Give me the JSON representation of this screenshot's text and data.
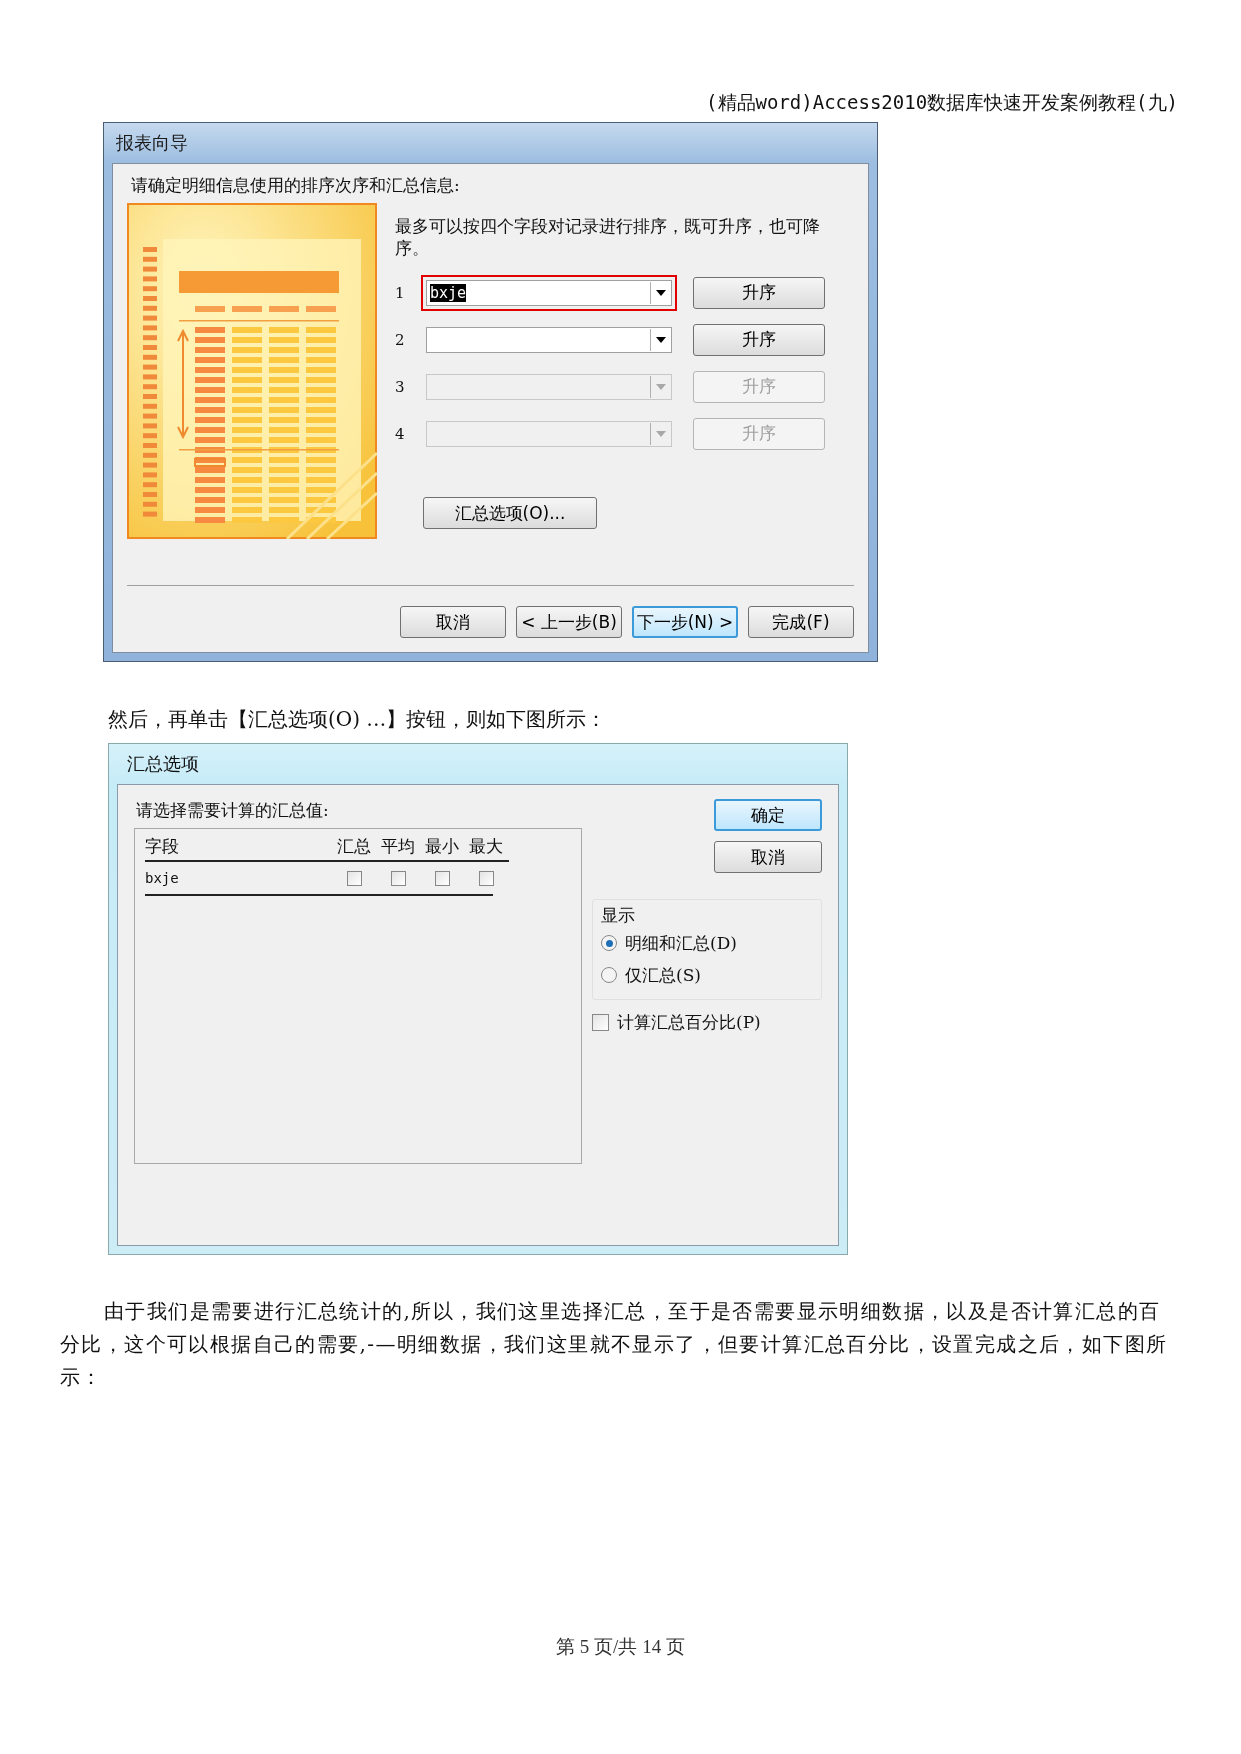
{
  "header": "(精品word)Access2010数据库快速开发案例教程(九)",
  "wizard": {
    "title": "报表向导",
    "prompt": "请确定明细信息使用的排序次序和汇总信息:",
    "note": "最多可以按四个字段对记录进行排序，既可升序，也可降序。",
    "sort_rows": [
      {
        "number": "1",
        "value": "bxje",
        "disabled": false,
        "highlighted": true,
        "button": "升序"
      },
      {
        "number": "2",
        "disabled": false,
        "highlighted": false,
        "button": "升序"
      },
      {
        "number": "3",
        "disabled": true,
        "highlighted": false,
        "button": "升序"
      },
      {
        "number": "4",
        "disabled": true,
        "highlighted": false,
        "button": "升序"
      }
    ],
    "summary_button": "汇总选项(O)...",
    "nav_buttons": [
      {
        "label": "取消",
        "default": false
      },
      {
        "label": "< 上一步(B)",
        "default": false
      },
      {
        "label": "下一步(N) >",
        "default": true
      },
      {
        "label": "完成(F)",
        "default": false
      }
    ]
  },
  "caption": "然后，再单击【汇总选项(O) …】按钮，则如下图所示：",
  "summary": {
    "title": "汇总选项",
    "prompt": "请选择需要计算的汇总值:",
    "columns": [
      "字段",
      "汇总",
      "平均",
      "最小",
      "最大"
    ],
    "rows": [
      {
        "field": "bxje",
        "checks": [
          false,
          false,
          false,
          false
        ]
      }
    ],
    "ok_button": "确定",
    "cancel_button": "取消",
    "group_label": "显示",
    "radios": [
      {
        "label": "明细和汇总(D)",
        "selected": true
      },
      {
        "label": "仅汇总(S)",
        "selected": false
      }
    ],
    "percent": {
      "label": "计算汇总百分比(P)",
      "checked": false
    }
  },
  "paragraph": "由于我们是需要进行汇总统计的,所以，我们这里选择汇总，至于是否需要显示明细数据，以及是否计算汇总的百分比，这个可以根据自己的需要,-—明细数据，我们这里就不显示了，但要计算汇总百分比，设置完成之后，如下图所示：",
  "footer": "第 5 页/共 14 页"
}
